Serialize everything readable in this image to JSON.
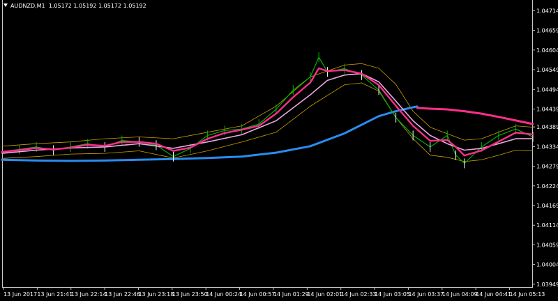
{
  "header": {
    "symbol": "AUDNZD,M1",
    "ohlc": "1.05172 1.05192 1.05172 1.05192"
  },
  "colors": {
    "background": "#000000",
    "price_up": "#00b000",
    "price_down": "#ffffff",
    "fast_ma": "#ff2d8a",
    "mid_ma": "#e8a8e0",
    "slow_ma": "#ff2d8a",
    "long_ma": "#2a8cf0",
    "envelope": "#c8a000",
    "axis": "#c8c8c8"
  },
  "chart_data": {
    "type": "line",
    "price_axis_labels": [
      "1.04714",
      "1.04659",
      "1.04604",
      "1.04549",
      "1.04494",
      "1.04439",
      "1.04389",
      "1.04334",
      "1.04279",
      "1.04224",
      "1.04169",
      "1.04114",
      "1.04059",
      "1.04004",
      "1.03949"
    ],
    "ylim": [
      1.03939,
      1.04744
    ],
    "time_axis_labels": [
      "13 Jun 2017",
      "13 Jun 21:41",
      "13 Jun 22:14",
      "13 Jun 22:46",
      "13 Jun 23:18",
      "13 Jun 23:50",
      "14 Jun 00:24",
      "14 Jun 00:57",
      "14 Jun 01:29",
      "14 Jun 02:01",
      "14 Jun 02:33",
      "14 Jun 03:05",
      "14 Jun 03:37",
      "14 Jun 04:09",
      "14 Jun 04:41",
      "14 Jun 05:13"
    ],
    "xlim": [
      0,
      496
    ],
    "series": [
      {
        "role": "price",
        "x": [
          0,
          16,
          32,
          48,
          64,
          80,
          96,
          112,
          128,
          144,
          160,
          176,
          192,
          208,
          224,
          240,
          256,
          272,
          288,
          296,
          304,
          320,
          336,
          352,
          368,
          384,
          400,
          416,
          424,
          432,
          448,
          464,
          480,
          496
        ],
        "values": [
          1.0432,
          1.04326,
          1.04333,
          1.04324,
          1.04333,
          1.04342,
          1.04333,
          1.04351,
          1.04347,
          1.04338,
          1.04306,
          1.04329,
          1.04365,
          1.04379,
          1.04383,
          1.04397,
          1.04438,
          1.04492,
          1.04529,
          1.04584,
          1.04543,
          1.04552,
          1.04534,
          1.04492,
          1.04415,
          1.04365,
          1.04333,
          1.04365,
          1.0431,
          1.04287,
          1.04333,
          1.04365,
          1.04383,
          1.04361
        ]
      },
      {
        "role": "fast_ma",
        "x": [
          0,
          16,
          32,
          48,
          64,
          80,
          96,
          112,
          128,
          144,
          160,
          176,
          192,
          208,
          224,
          240,
          256,
          272,
          288,
          296,
          304,
          320,
          336,
          352,
          368,
          384,
          400,
          416,
          424,
          432,
          448,
          464,
          480,
          496
        ],
        "values": [
          1.04319,
          1.04324,
          1.0433,
          1.04326,
          1.04331,
          1.04339,
          1.04336,
          1.04347,
          1.04347,
          1.04342,
          1.04322,
          1.04331,
          1.04356,
          1.04372,
          1.04381,
          1.04392,
          1.04426,
          1.04472,
          1.04513,
          1.04553,
          1.04545,
          1.04548,
          1.04538,
          1.04506,
          1.04448,
          1.04392,
          1.0435,
          1.04352,
          1.04333,
          1.04309,
          1.04323,
          1.04348,
          1.04373,
          1.04368
        ]
      },
      {
        "role": "mid_ma",
        "x": [
          0,
          32,
          64,
          96,
          128,
          160,
          192,
          224,
          256,
          288,
          304,
          320,
          336,
          352,
          368,
          384,
          400,
          416,
          432,
          448,
          464,
          480,
          496
        ],
        "values": [
          1.04315,
          1.04324,
          1.0433,
          1.04333,
          1.04342,
          1.04329,
          1.04347,
          1.04367,
          1.04406,
          1.04479,
          1.04519,
          1.04534,
          1.04538,
          1.04515,
          1.04461,
          1.04406,
          1.04365,
          1.04342,
          1.04324,
          1.04329,
          1.04342,
          1.04356,
          1.04356
        ]
      },
      {
        "role": "slow_ma",
        "x": [
          388,
          400,
          416,
          432,
          448,
          464,
          480,
          496
        ],
        "values": [
          1.04442,
          1.0444,
          1.04438,
          1.04433,
          1.04426,
          1.04417,
          1.04407,
          1.04397
        ]
      },
      {
        "role": "long_ma",
        "x": [
          0,
          32,
          64,
          96,
          128,
          160,
          192,
          224,
          256,
          288,
          320,
          352,
          368,
          384,
          388
        ],
        "values": [
          1.04297,
          1.04295,
          1.04294,
          1.04295,
          1.04297,
          1.04299,
          1.04302,
          1.04306,
          1.04317,
          1.04335,
          1.04371,
          1.04419,
          1.04433,
          1.04444,
          1.04446
        ]
      },
      {
        "role": "envelope_upper",
        "x": [
          0,
          32,
          64,
          96,
          128,
          160,
          192,
          224,
          256,
          288,
          320,
          336,
          352,
          368,
          384,
          400,
          416,
          432,
          448,
          464,
          480,
          496
        ],
        "values": [
          1.04335,
          1.04342,
          1.04347,
          1.04356,
          1.04361,
          1.04356,
          1.04374,
          1.04392,
          1.04447,
          1.04529,
          1.04562,
          1.04566,
          1.04553,
          1.04508,
          1.04433,
          1.04388,
          1.0437,
          1.04352,
          1.04356,
          1.04374,
          1.04392,
          1.04388
        ]
      },
      {
        "role": "envelope_lower",
        "x": [
          0,
          32,
          64,
          96,
          128,
          160,
          192,
          224,
          256,
          288,
          320,
          336,
          352,
          368,
          384,
          400,
          416,
          432,
          448,
          464,
          480,
          496
        ],
        "values": [
          1.04301,
          1.04306,
          1.04313,
          1.04315,
          1.04322,
          1.04302,
          1.04322,
          1.04347,
          1.04374,
          1.04447,
          1.04507,
          1.04512,
          1.04489,
          1.04415,
          1.04356,
          1.0431,
          1.04304,
          1.04292,
          1.04297,
          1.0431,
          1.04324,
          1.04322
        ]
      }
    ],
    "grid": false
  }
}
